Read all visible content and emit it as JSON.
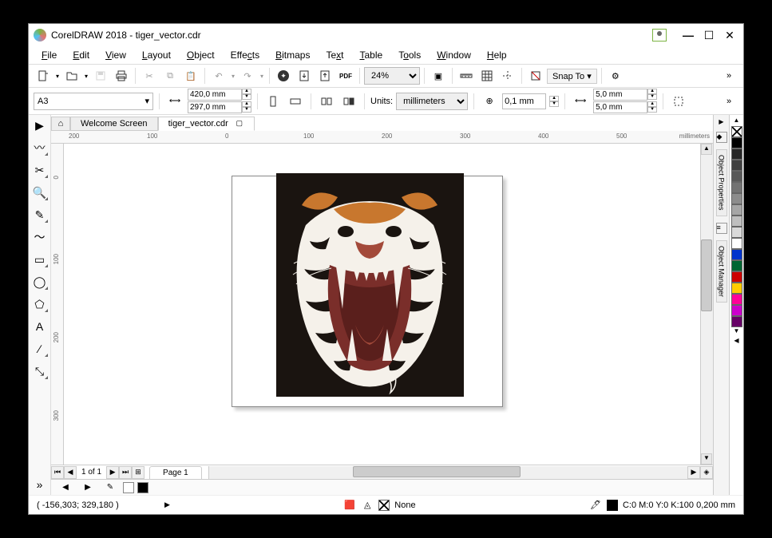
{
  "titlebar": {
    "app": "CorelDRAW 2018",
    "doc": "tiger_vector.cdr"
  },
  "menu": {
    "file": "File",
    "edit": "Edit",
    "view": "View",
    "layout": "Layout",
    "object": "Object",
    "effects": "Effects",
    "bitmaps": "Bitmaps",
    "text": "Text",
    "table": "Table",
    "tools": "Tools",
    "window": "Window",
    "help": "Help"
  },
  "toolbar": {
    "zoom": "24%",
    "snapto": "Snap To",
    "pdf": "PDF"
  },
  "propbar": {
    "page_size": "A3",
    "width": "420,0 mm",
    "height": "297,0 mm",
    "units_label": "Units:",
    "units": "millimeters",
    "nudge": "0,1 mm",
    "dup_x": "5,0 mm",
    "dup_y": "5,0 mm"
  },
  "tabs": {
    "welcome": "Welcome Screen",
    "doc": "tiger_vector.cdr"
  },
  "ruler": {
    "h": [
      "200",
      "100",
      "0",
      "100",
      "200",
      "300",
      "400",
      "500"
    ],
    "h_unit": "millimeters",
    "v": [
      "0",
      "100",
      "200",
      "300"
    ]
  },
  "pager": {
    "pos": "1 of 1",
    "page": "Page 1"
  },
  "dockers": {
    "props": "Object Properties",
    "mgr": "Object Manager"
  },
  "palette": {
    "colors": [
      "#000000",
      "#262626",
      "#404040",
      "#595959",
      "#737373",
      "#8c8c8c",
      "#a6a6a6",
      "#bfbfbf",
      "#d9d9d9",
      "#ffffff",
      "#0033cc",
      "#006633",
      "#cc0000",
      "#ffcc00",
      "#ff0099",
      "#cc00cc",
      "#660066"
    ]
  },
  "status": {
    "coords": "( -156,303; 329,180 )",
    "fill": "None",
    "outline": "C:0 M:0 Y:0 K:100  0,200 mm"
  }
}
